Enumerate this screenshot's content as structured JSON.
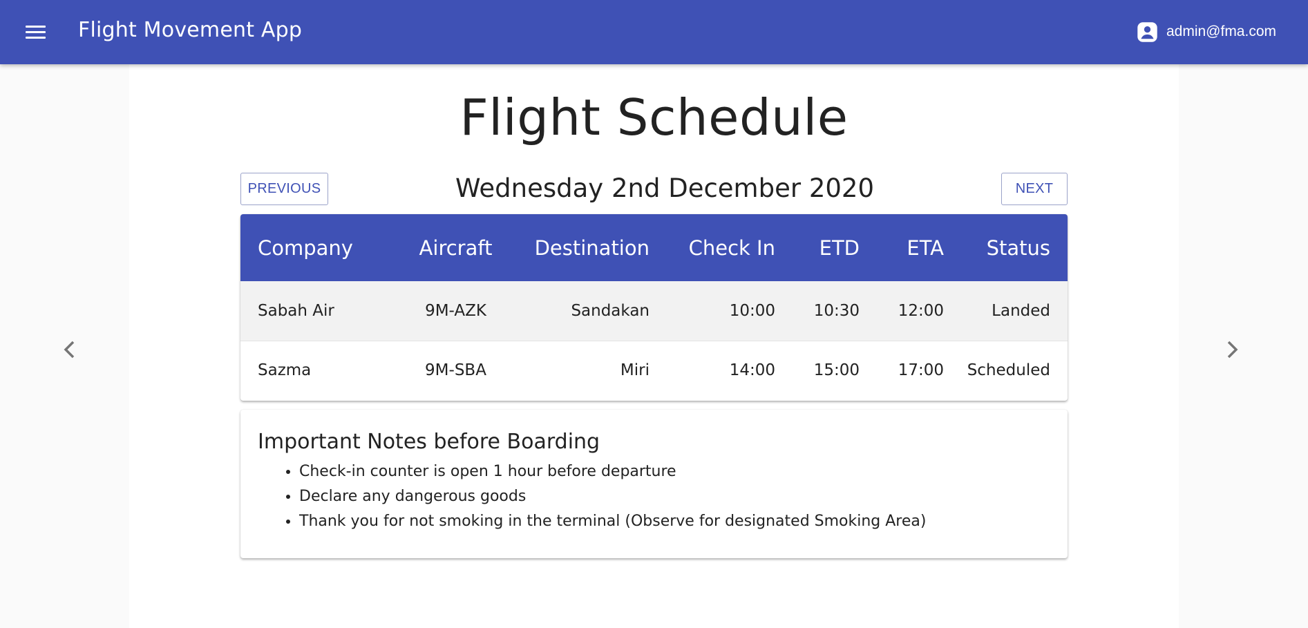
{
  "appbar": {
    "title": "Flight Movement App",
    "user_email": "admin@fma.com",
    "menu_icon": "hamburger-menu-icon",
    "user_icon": "account-circle-icon",
    "color": "#3f51b5"
  },
  "page": {
    "title": "Flight Schedule",
    "date": "Wednesday 2nd December 2020",
    "prev_label": "PREVIOUS",
    "next_label": "NEXT"
  },
  "table": {
    "headers": [
      "Company",
      "Aircraft",
      "Destination",
      "Check In",
      "ETD",
      "ETA",
      "Status"
    ],
    "rows": [
      [
        "Sabah Air",
        "9M-AZK",
        "Sandakan",
        "10:00",
        "10:30",
        "12:00",
        "Landed"
      ],
      [
        "Sazma",
        "9M-SBA",
        "Miri",
        "14:00",
        "15:00",
        "17:00",
        "Scheduled"
      ]
    ]
  },
  "notes": {
    "title": "Important Notes before Boarding",
    "items": [
      "Check-in counter is open 1 hour before departure",
      "Declare any dangerous goods",
      "Thank you for not smoking in the terminal (Observe for designated Smoking Area)"
    ]
  },
  "carousel": {
    "left_icon": "chevron-left-icon",
    "right_icon": "chevron-right-icon"
  }
}
